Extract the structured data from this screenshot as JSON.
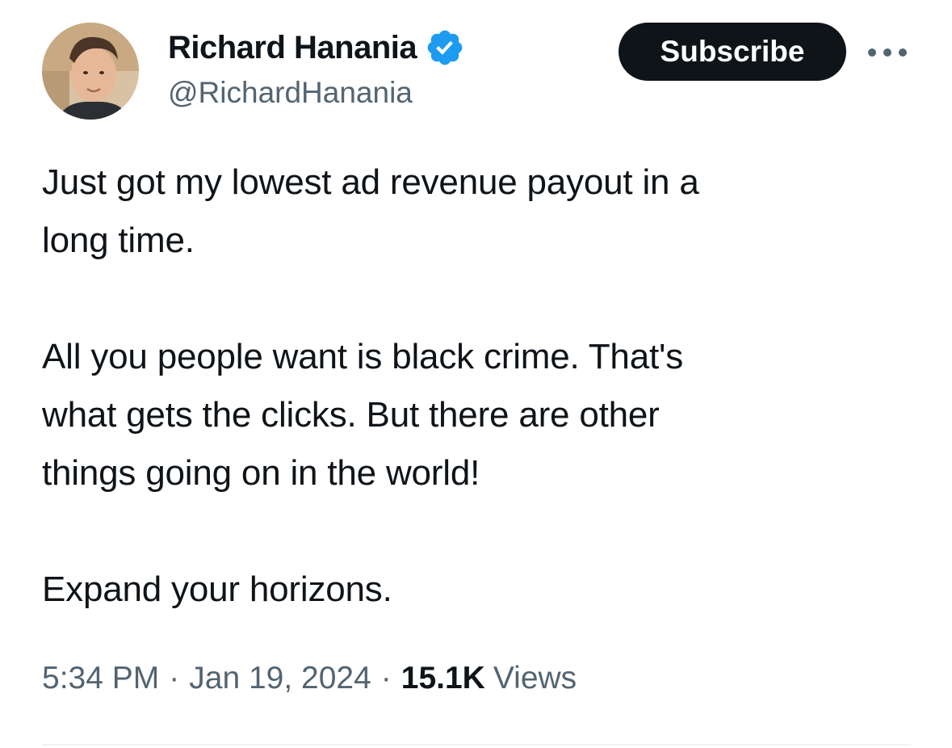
{
  "author": {
    "display_name": "Richard Hanania",
    "handle": "@RichardHanania",
    "verified": true,
    "avatar_icon": "profile-photo"
  },
  "actions": {
    "subscribe_label": "Subscribe",
    "more_icon": "more-horizontal-icon"
  },
  "tweet": {
    "paragraphs": [
      "Just got my lowest ad revenue payout in a\nlong time.",
      "All you people want is black crime. That's\nwhat gets the clicks. But there are other\nthings going on in the world!",
      "Expand your horizons."
    ]
  },
  "meta": {
    "time": "5:34 PM",
    "separator": "·",
    "date": "Jan 19, 2024",
    "views_count": "15.1K",
    "views_label": "Views"
  },
  "colors": {
    "text": "#0f1419",
    "secondary": "#536471",
    "verified_badge": "#1d9bf0",
    "button_bg": "#0f1419",
    "divider": "#eff3f4"
  }
}
